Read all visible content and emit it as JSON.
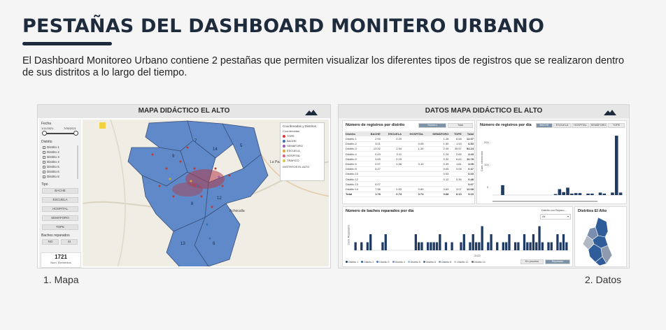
{
  "page": {
    "title": "PESTAÑAS DEL DASHBOARD MONITERO URBANO",
    "description": "El Dashboard Monitoreo Urbano contiene 2 pestañas que permiten visualizar los diferentes tipos de registros que se realizaron dentro de sus distritos a lo largo del tiempo.",
    "caption_left": "1. Mapa",
    "caption_right": "2. Datos"
  },
  "map_tab": {
    "title": "MAPA DIDÁCTICO EL ALTO",
    "logo_text": "Created by Altitude",
    "sidebar": {
      "date_label": "Fecha",
      "date_start": "1/11/2021",
      "date_end": "7/05/2021",
      "district_label": "Distrito",
      "districts": [
        "Distrito 1",
        "Distrito 2",
        "Distrito 3",
        "Distrito 4",
        "Distrito 5",
        "Distrito 6",
        "Distrito 8"
      ],
      "type_label": "Tipo",
      "types": [
        "BACHE",
        "ESCUELA",
        "HOSPITAL",
        "SEMÁFORO",
        "TOPE"
      ],
      "repaired_label": "Baches reparados",
      "repaired_options": [
        "NO",
        "SI"
      ],
      "count_value": "1721",
      "count_label": "Num. Elementos"
    },
    "legend": {
      "title": "Coordenadas y Distritos",
      "sub": "Coordenadas",
      "items": [
        {
          "label": "TOPE",
          "color": "#d9343a"
        },
        {
          "label": "BACHE",
          "color": "#3a6fb0"
        },
        {
          "label": "SEMÁFORO",
          "color": "#9b59b6"
        },
        {
          "label": "ESCUELA",
          "color": "#e0a72e"
        },
        {
          "label": "HOSPITAL",
          "color": "#e55a8c"
        },
        {
          "label": "TRÁFICO",
          "color": "#d6c74a"
        }
      ],
      "footer": "DISTRITOS EL ALTO"
    },
    "district_numbers": [
      "7",
      "14",
      "9",
      "5",
      "8",
      "12",
      "13",
      "6"
    ],
    "place_labels": [
      "La Paz",
      "Achocalla"
    ]
  },
  "data_tab": {
    "title": "DATOS MAPA DIDÁCTICO EL ALTO",
    "table_card": {
      "title": "Número de registros por distrito",
      "toggle": [
        "Número",
        "Total"
      ],
      "headers": [
        "Distrito",
        "BACHE",
        "ESCUELA",
        "HOSPITAL",
        "SEMÁFORO",
        "TOPE",
        "Total"
      ],
      "rows": [
        [
          "Distrito 1",
          "2.93",
          "0.29",
          "",
          "1.28",
          "8.58",
          "12.07"
        ],
        [
          "Distrito 2",
          "3.01",
          "",
          "0.06",
          "1.50",
          "1.93",
          "6.53"
        ],
        [
          "Distrito 3",
          "13.32",
          "2.54",
          "1.34",
          "2.49",
          "35.57",
          "54.24"
        ],
        [
          "Distrito 4",
          "0.43",
          "0.11",
          "",
          "1.24",
          "2.65",
          "4.43"
        ],
        [
          "Distrito 5",
          "3.69",
          "0.15",
          "",
          "0.32",
          "6.62",
          "10.78"
        ],
        [
          "Distrito 6",
          "0.97",
          "0.06",
          "0.19",
          "0.39",
          "1.81",
          "3.05"
        ],
        [
          "Distrito 8",
          "0.27",
          "",
          "",
          "0.05",
          "0.05",
          "0.37"
        ],
        [
          "Distrito 10",
          "",
          "",
          "",
          "0.03",
          "",
          "0.03"
        ],
        [
          "Distrito 12",
          "",
          "",
          "",
          "0.12",
          "0.36",
          "0.48"
        ],
        [
          "Distrito 13",
          "0.07",
          "",
          "",
          "",
          "",
          "0.07"
        ],
        [
          "Distrito 14",
          "7.56",
          "0.53",
          "0.89",
          "0.63",
          "3.07",
          "12.68"
        ],
        [
          "Total",
          "1.78",
          "0.74",
          "0.74",
          "0.68",
          "6.13",
          "5.19"
        ]
      ]
    },
    "day_chart": {
      "title": "Número de registros por día",
      "filters": [
        "BACHE",
        "ESCUELA",
        "HOSPITAL",
        "SEMÁFORO",
        "TOPE"
      ],
      "ylabel": "Cant. elementos",
      "yticks": [
        "200",
        "100",
        "0"
      ]
    },
    "repaired_chart": {
      "title": "Número de baches reparados por día",
      "dropdown": "Distrito con Reparo...",
      "dropdown_value": "All",
      "ylabel": "Cant. Reparados",
      "year_label": "2022",
      "buttons": [
        "En proceso",
        "Reparado"
      ],
      "legend": [
        "Distrito 1",
        "Distrito 2",
        "Distrito 3",
        "Distrito 4",
        "Distrito 5",
        "Distrito 6",
        "Distrito 8",
        "Distrito 12",
        "Distrito 14"
      ]
    },
    "districts_map": {
      "title": "Distritos El Alto"
    }
  },
  "chart_data": [
    {
      "type": "bar",
      "title": "Número de registros por día",
      "ylabel": "Cant. elementos",
      "ylim": [
        0,
        260
      ],
      "values": [
        0,
        0,
        40,
        0,
        0,
        0,
        0,
        0,
        0,
        0,
        0,
        0,
        0,
        0,
        0,
        4,
        24,
        12,
        30,
        6,
        8,
        8,
        0,
        6,
        6,
        0,
        10,
        6,
        0,
        10,
        240,
        10
      ]
    },
    {
      "type": "bar",
      "title": "Número de baches reparados por día",
      "ylabel": "Cant. Reparados",
      "ylim": [
        0,
        4
      ],
      "values": [
        1,
        0,
        1,
        0,
        1,
        2,
        0,
        0,
        0,
        1,
        2,
        0,
        0,
        0,
        0,
        0,
        0,
        0,
        0,
        0,
        2,
        1,
        1,
        0,
        1,
        1,
        1,
        1,
        2,
        0,
        1,
        0,
        1,
        0,
        0,
        1,
        2,
        0,
        1,
        2,
        1,
        1,
        3,
        0,
        1,
        2,
        0,
        1,
        0,
        1,
        1,
        2,
        0,
        1,
        1,
        0,
        2,
        1,
        1,
        2,
        1,
        3,
        1,
        0,
        1,
        1,
        0,
        2,
        1,
        2,
        1
      ]
    }
  ]
}
